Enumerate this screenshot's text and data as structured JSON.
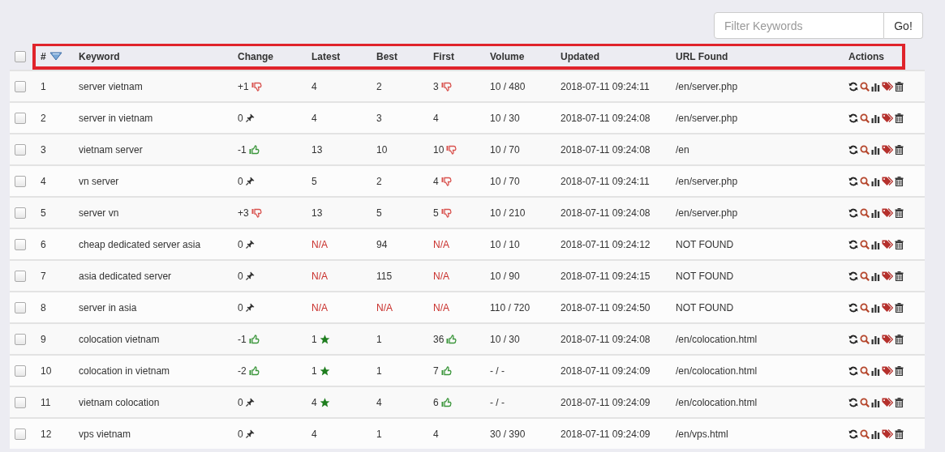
{
  "filter": {
    "placeholder": "Filter Keywords",
    "button": "Go!"
  },
  "header": {
    "checked": false,
    "columns": [
      "#",
      "Keyword",
      "Change",
      "Latest",
      "Best",
      "First",
      "Volume",
      "Updated",
      "URL Found",
      "Actions"
    ]
  },
  "rows": [
    {
      "checked": false,
      "num": "1",
      "keyword": "server vietnam",
      "change": {
        "text": "+1",
        "kind": "worse"
      },
      "latest": {
        "text": "4"
      },
      "best": {
        "text": "2"
      },
      "first": {
        "text": "3",
        "kind": "worse"
      },
      "volume": "10 / 480",
      "updated": "2018-07-11 09:24:11",
      "url": "/en/server.php"
    },
    {
      "checked": false,
      "num": "2",
      "keyword": "server in vietnam",
      "change": {
        "text": "0",
        "kind": "unchanged"
      },
      "latest": {
        "text": "4"
      },
      "best": {
        "text": "3"
      },
      "first": {
        "text": "4"
      },
      "volume": "10 / 30",
      "updated": "2018-07-11 09:24:08",
      "url": "/en/server.php"
    },
    {
      "checked": false,
      "num": "3",
      "keyword": "vietnam server",
      "change": {
        "text": "-1",
        "kind": "better"
      },
      "latest": {
        "text": "13"
      },
      "best": {
        "text": "10"
      },
      "first": {
        "text": "10",
        "kind": "worse"
      },
      "volume": "10 / 70",
      "updated": "2018-07-11 09:24:08",
      "url": "/en"
    },
    {
      "checked": false,
      "num": "4",
      "keyword": "vn server",
      "change": {
        "text": "0",
        "kind": "unchanged"
      },
      "latest": {
        "text": "5"
      },
      "best": {
        "text": "2"
      },
      "first": {
        "text": "4",
        "kind": "worse"
      },
      "volume": "10 / 70",
      "updated": "2018-07-11 09:24:11",
      "url": "/en/server.php"
    },
    {
      "checked": false,
      "num": "5",
      "keyword": "server vn",
      "change": {
        "text": "+3",
        "kind": "worse"
      },
      "latest": {
        "text": "13"
      },
      "best": {
        "text": "5"
      },
      "first": {
        "text": "5",
        "kind": "worse"
      },
      "volume": "10 / 210",
      "updated": "2018-07-11 09:24:08",
      "url": "/en/server.php"
    },
    {
      "checked": false,
      "num": "6",
      "keyword": "cheap dedicated server asia",
      "change": {
        "text": "0",
        "kind": "unchanged"
      },
      "latest": {
        "text": "N/A",
        "missing": true
      },
      "best": {
        "text": "94"
      },
      "first": {
        "text": "N/A",
        "missing": true
      },
      "volume": "10 / 10",
      "updated": "2018-07-11 09:24:12",
      "url": "NOT FOUND"
    },
    {
      "checked": false,
      "num": "7",
      "keyword": "asia dedicated server",
      "change": {
        "text": "0",
        "kind": "unchanged"
      },
      "latest": {
        "text": "N/A",
        "missing": true
      },
      "best": {
        "text": "115"
      },
      "first": {
        "text": "N/A",
        "missing": true
      },
      "volume": "10 / 90",
      "updated": "2018-07-11 09:24:15",
      "url": "NOT FOUND"
    },
    {
      "checked": false,
      "num": "8",
      "keyword": "server in asia",
      "change": {
        "text": "0",
        "kind": "unchanged"
      },
      "latest": {
        "text": "N/A",
        "missing": true
      },
      "best": {
        "text": "N/A",
        "missing": true
      },
      "first": {
        "text": "N/A",
        "missing": true
      },
      "volume": "110 / 720",
      "updated": "2018-07-11 09:24:50",
      "url": "NOT FOUND"
    },
    {
      "checked": false,
      "num": "9",
      "keyword": "colocation vietnam",
      "change": {
        "text": "-1",
        "kind": "better"
      },
      "latest": {
        "text": "1",
        "kind": "top"
      },
      "best": {
        "text": "1"
      },
      "first": {
        "text": "36",
        "kind": "better"
      },
      "volume": "10 / 30",
      "updated": "2018-07-11 09:24:08",
      "url": "/en/colocation.html"
    },
    {
      "checked": false,
      "num": "10",
      "keyword": "colocation in vietnam",
      "change": {
        "text": "-2",
        "kind": "better"
      },
      "latest": {
        "text": "1",
        "kind": "top"
      },
      "best": {
        "text": "1"
      },
      "first": {
        "text": "7",
        "kind": "better"
      },
      "volume": "- / -",
      "updated": "2018-07-11 09:24:09",
      "url": "/en/colocation.html"
    },
    {
      "checked": false,
      "num": "11",
      "keyword": "vietnam colocation",
      "change": {
        "text": "0",
        "kind": "unchanged"
      },
      "latest": {
        "text": "4",
        "kind": "top"
      },
      "best": {
        "text": "4"
      },
      "first": {
        "text": "6",
        "kind": "better"
      },
      "volume": "- / -",
      "updated": "2018-07-11 09:24:09",
      "url": "/en/colocation.html"
    },
    {
      "checked": false,
      "num": "12",
      "keyword": "vps vietnam",
      "change": {
        "text": "0",
        "kind": "unchanged"
      },
      "latest": {
        "text": "4"
      },
      "best": {
        "text": "1"
      },
      "first": {
        "text": "4"
      },
      "volume": "30 / 390",
      "updated": "2018-07-11 09:24:09",
      "url": "/en/vps.html"
    }
  ]
}
